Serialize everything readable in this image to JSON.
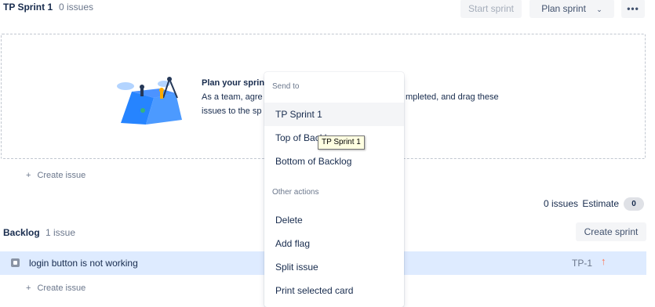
{
  "sprint": {
    "title": "TP Sprint 1",
    "count": "0 issues",
    "start_label": "Start sprint",
    "plan_label": "Plan sprint",
    "more_label": "•••",
    "empty": {
      "heading": "Plan your sprin",
      "text_line1": "As a team, agre",
      "text_line1_tail": "mpleted, and drag these",
      "text_line2": "issues to the sp"
    },
    "create_issue": "Create issue"
  },
  "summary": {
    "issues": "0 issues",
    "estimate_label": "Estimate",
    "estimate_value": "0"
  },
  "backlog": {
    "title": "Backlog",
    "count": "1 issue",
    "create_sprint_label": "Create sprint",
    "issues": [
      {
        "summary": "login button is not working",
        "key": "TP-1",
        "priority_icon": "arrow-up-icon"
      }
    ],
    "create_issue": "Create issue"
  },
  "menu": {
    "send_to_label": "Send to",
    "send_to_items": [
      "TP Sprint 1",
      "Top of Backlog",
      "Bottom of Backlog"
    ],
    "other_label": "Other actions",
    "other_items": [
      "Delete",
      "Add flag",
      "Split issue",
      "Print selected card"
    ]
  },
  "tooltip": "TP Sprint 1",
  "colors": {
    "selected_row": "#deebff",
    "priority": "#ff7452",
    "text": "#172b4d",
    "muted": "#6b778c"
  }
}
